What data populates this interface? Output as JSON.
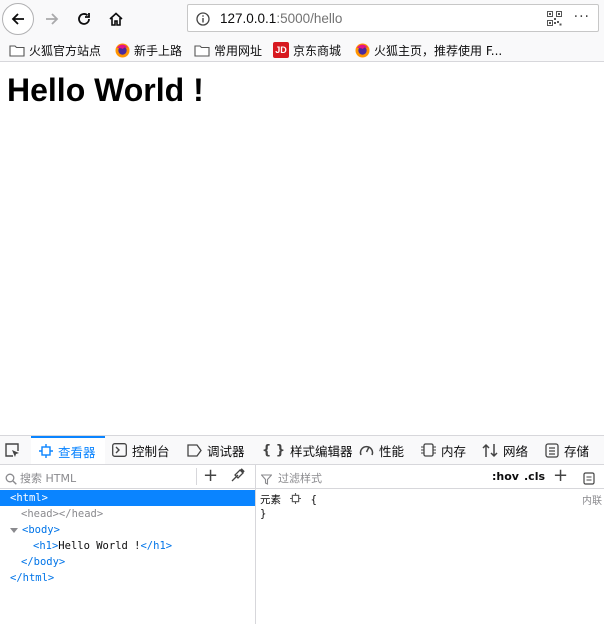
{
  "nav": {
    "back": "back",
    "forward": "forward",
    "reload": "reload",
    "home": "home"
  },
  "urlbar": {
    "host": "127.0.0.1",
    "path": ":5000/hello",
    "more": "···"
  },
  "bookmarks": [
    {
      "label": "火狐官方站点",
      "icon": "folder-icon"
    },
    {
      "label": "新手上路",
      "icon": "firefox-icon"
    },
    {
      "label": "常用网址",
      "icon": "folder-icon"
    },
    {
      "label": "京东商城",
      "icon": "jd-icon",
      "badge": "JD"
    },
    {
      "label": "火狐主页，推荐使用 F...",
      "icon": "firefox-icon"
    }
  ],
  "page": {
    "heading": "Hello World !"
  },
  "devtools": {
    "tabs": [
      {
        "label": "查看器",
        "icon": "inspector-icon"
      },
      {
        "label": "控制台",
        "icon": "console-icon"
      },
      {
        "label": "调试器",
        "icon": "debugger-icon"
      },
      {
        "label": "样式编辑器",
        "icon": "style-editor-icon",
        "prefix": "{ }"
      },
      {
        "label": "性能",
        "icon": "performance-icon"
      },
      {
        "label": "内存",
        "icon": "memory-icon"
      },
      {
        "label": "网络",
        "icon": "network-icon"
      },
      {
        "label": "存储",
        "icon": "storage-icon"
      }
    ],
    "search_placeholder": "搜索 HTML",
    "filter_placeholder": "过滤样式",
    "hov": ":hov",
    "cls": ".cls",
    "tree": {
      "html_open": "<html>",
      "head": "<head></head>",
      "body_open": "<body>",
      "h1_open": "<h1>",
      "h1_text": "Hello World !",
      "h1_close": "</h1>",
      "body_close": "</body>",
      "html_close": "</html>"
    },
    "rules": {
      "element": "元素",
      "open_brace": "{",
      "close_brace": "}",
      "inline": "内联"
    }
  }
}
